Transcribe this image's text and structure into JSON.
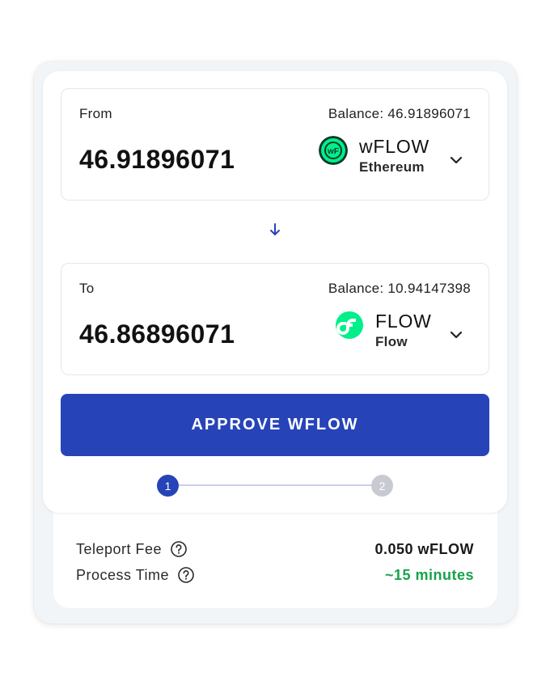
{
  "from": {
    "label": "From",
    "balance": "Balance: 46.91896071",
    "amount": "46.91896071",
    "token_symbol": "wFLOW",
    "token_network": "Ethereum",
    "token_icon": "wflow-token-icon"
  },
  "to": {
    "label": "To",
    "balance": "Balance: 10.94147398",
    "amount": "46.86896071",
    "token_symbol": "FLOW",
    "token_network": "Flow",
    "token_icon": "flow-token-icon"
  },
  "swap_icon": "arrow-down-icon",
  "approve_button": "APPROVE WFLOW",
  "stepper": {
    "steps": [
      "1",
      "2"
    ],
    "active_step": "1"
  },
  "fee": {
    "label": "Teleport Fee",
    "value": "0.050 wFLOW"
  },
  "process_time": {
    "label": "Process Time",
    "value": "~15 minutes"
  },
  "colors": {
    "primary": "#2743b8",
    "flow_green": "#00ef8b",
    "success_text": "#16a34a",
    "step_inactive": "#c7cbd1"
  }
}
